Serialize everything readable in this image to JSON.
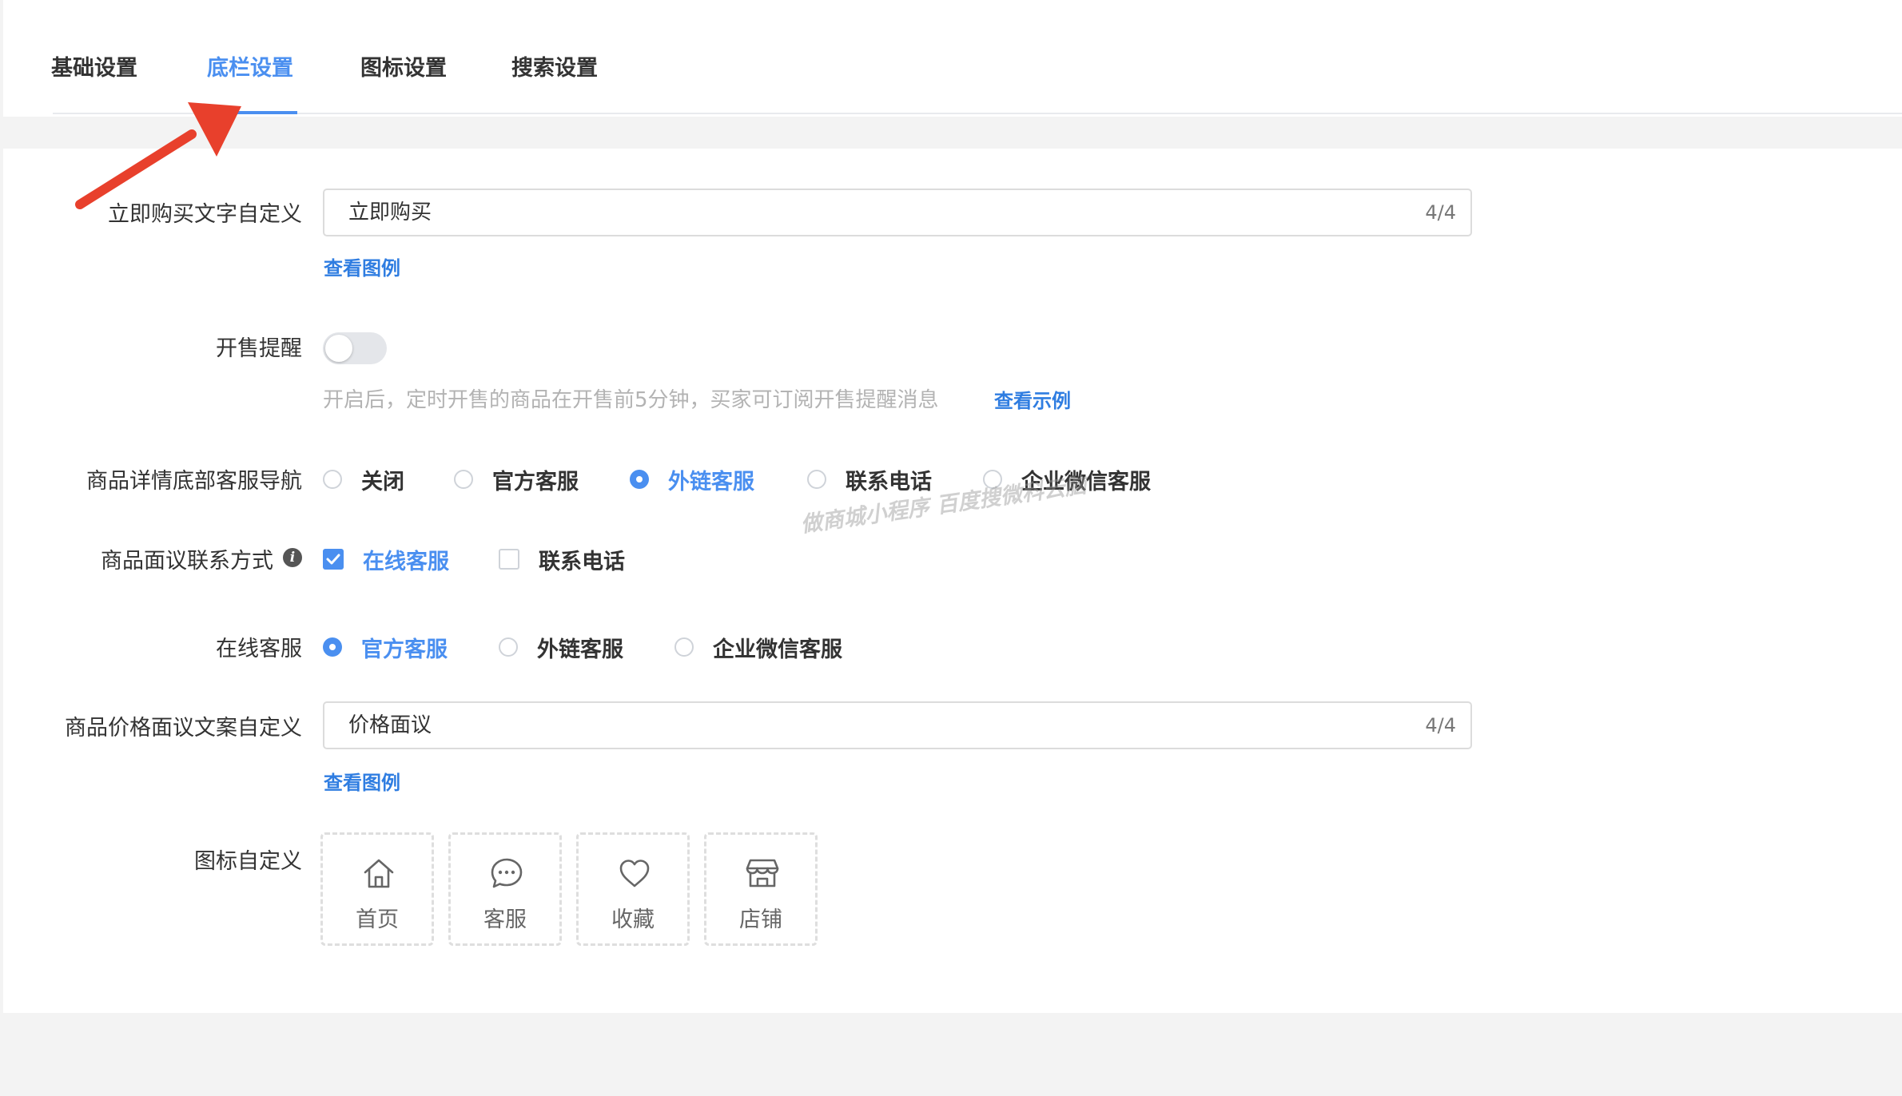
{
  "tabs": [
    {
      "label": "基础设置",
      "active": false
    },
    {
      "label": "底栏设置",
      "active": true
    },
    {
      "label": "图标设置",
      "active": false
    },
    {
      "label": "搜索设置",
      "active": false
    }
  ],
  "buy_text": {
    "label": "立即购买文字自定义",
    "value": "立即购买",
    "count": "4/4",
    "example_link": "查看图例"
  },
  "sale_reminder": {
    "label": "开售提醒",
    "enabled": false,
    "hint": "开启后，定时开售的商品在开售前5分钟，买家可订阅开售提醒消息",
    "example_link": "查看示例"
  },
  "detail_nav": {
    "label": "商品详情底部客服导航",
    "options": [
      "关闭",
      "官方客服",
      "外链客服",
      "联系电话",
      "企业微信客服"
    ],
    "selected": "外链客服"
  },
  "negotiation_contact": {
    "label": "商品面议联系方式",
    "info_icon": "i",
    "options": [
      {
        "label": "在线客服",
        "checked": true
      },
      {
        "label": "联系电话",
        "checked": false
      }
    ]
  },
  "online_service": {
    "label": "在线客服",
    "options": [
      "官方客服",
      "外链客服",
      "企业微信客服"
    ],
    "selected": "官方客服"
  },
  "price_text": {
    "label": "商品价格面议文案自定义",
    "value": "价格面议",
    "count": "4/4",
    "example_link": "查看图例"
  },
  "icon_custom": {
    "label": "图标自定义",
    "icons": [
      {
        "label": "首页",
        "icon": "home-icon"
      },
      {
        "label": "客服",
        "icon": "chat-icon"
      },
      {
        "label": "收藏",
        "icon": "heart-icon"
      },
      {
        "label": "店铺",
        "icon": "store-icon"
      }
    ]
  },
  "watermark": "做商城小程序 百度搜微科云脑",
  "colors": {
    "accent": "#4a8ff0",
    "link": "#2f7de1",
    "annotation_arrow": "#e8402c"
  }
}
